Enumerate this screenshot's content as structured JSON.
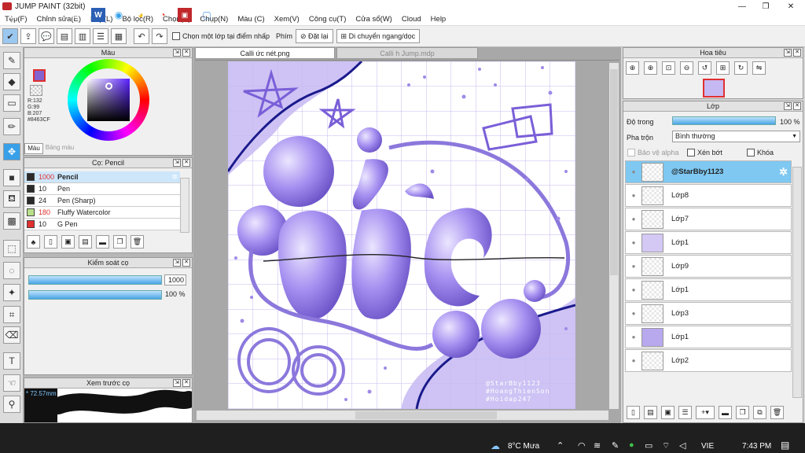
{
  "window": {
    "title": "JUMP PAINT (32bit)"
  },
  "menu": [
    "Tệp(F)",
    "Chỉnh sửa(E)",
    "Lớp(L)",
    "Bộ lọc(R)",
    "Chọn(S)",
    "Chụp(N)",
    "Màu (C)",
    "Xem(V)",
    "Công cụ(T)",
    "Cửa sổ(W)",
    "Cloud",
    "Help"
  ],
  "toolbar": {
    "select_layer_label": "Chọn một lớp tại điểm nhấp",
    "key_label": "Phím",
    "reset_label": "Đặt lại",
    "move_label": "Di chuyển ngang/dọc"
  },
  "color_panel": {
    "title": "Màu",
    "rgb": [
      "R:132",
      "G:99",
      "B:207",
      "#8463CF"
    ],
    "tab_color": "Màu",
    "tab_palette": "Bảng màu",
    "current_color": "#8463CF"
  },
  "brush_panel": {
    "title": "Cọ: Pencil",
    "items": [
      {
        "size": "1000",
        "name": "Pencil",
        "color": "#2a2a2a",
        "size_color": "#e03030"
      },
      {
        "size": "10",
        "name": "Pen",
        "color": "#2a2a2a",
        "size_color": "#222222"
      },
      {
        "size": "24",
        "name": "Pen (Sharp)",
        "color": "#2a2a2a",
        "size_color": "#222222"
      },
      {
        "size": "180",
        "name": "Fluffy Watercolor",
        "color": "#b8e08a",
        "size_color": "#e03030"
      },
      {
        "size": "10",
        "name": "G Pen",
        "color": "#e03030",
        "size_color": "#222222"
      }
    ]
  },
  "brush_control": {
    "title": "Kiểm soát cọ",
    "size_value": "1000",
    "opacity_value": "100 %"
  },
  "brush_preview": {
    "title": "Xem trước cọ",
    "size": "* 72.57mm"
  },
  "tabs": {
    "active": "Calli ức nét.png",
    "inactive": "Calli h Jump.mdp"
  },
  "navigator": {
    "title": "Hoa tiêu"
  },
  "layer_panel": {
    "title": "Lớp",
    "opacity_label": "Độ trong",
    "opacity_value": "100 %",
    "blend_label": "Pha trộn",
    "blend_value": "Bình thường",
    "protect_alpha": "Bảo vệ alpha",
    "clipping": "Xén bớt",
    "lock": "Khóa",
    "layers": [
      "@StarBby1123",
      "Lớp8",
      "Lớp7",
      "Lớp1",
      "Lớp9",
      "Lớp1",
      "Lớp3",
      "Lớp1",
      "Lớp2"
    ]
  },
  "watermark": [
    "@StarBby1123",
    "#HoangThienSon",
    "#Hoidap247"
  ],
  "taskbar": {
    "weather": "8°C Mưa",
    "lang": "VIE",
    "time": "7:43 PM"
  }
}
